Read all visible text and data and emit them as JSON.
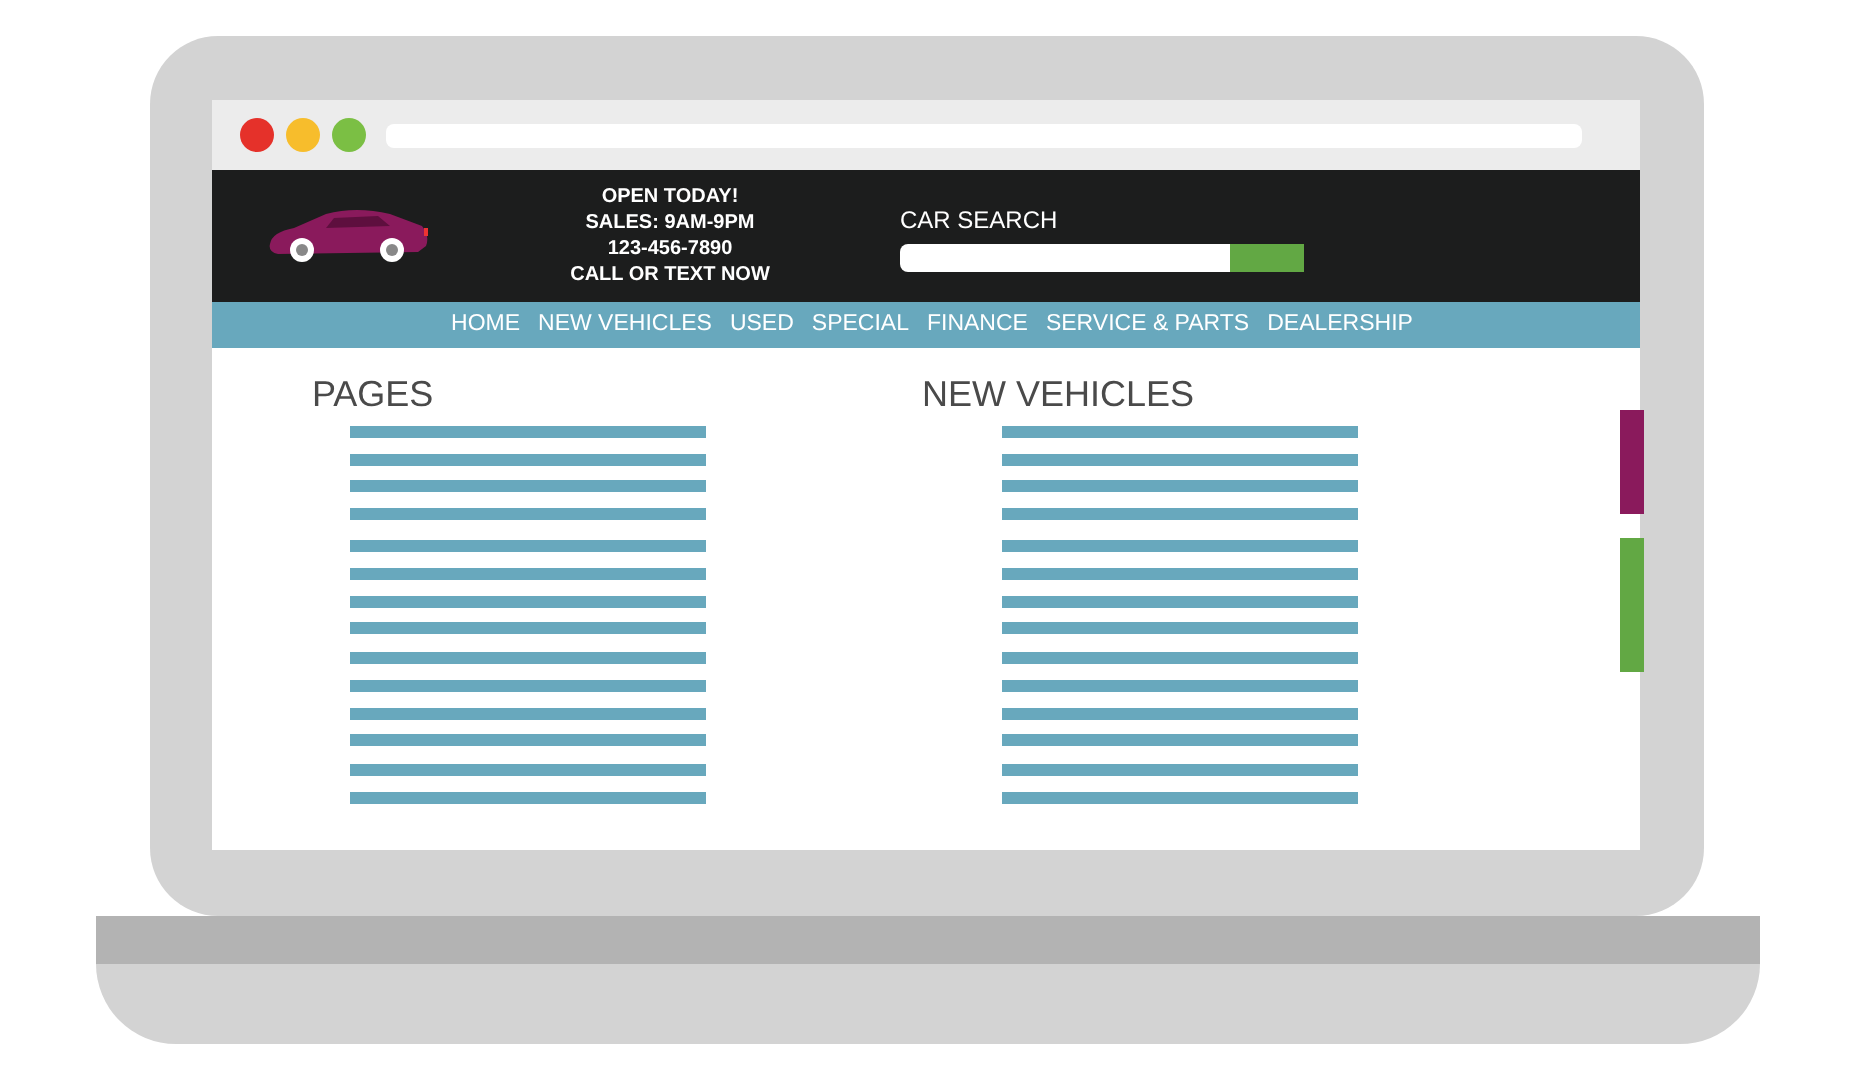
{
  "header": {
    "info_lines": [
      "OPEN TODAY!",
      "SALES: 9AM-9PM",
      "123-456-7890",
      "CALL OR TEXT NOW"
    ],
    "search": {
      "label": "CAR SEARCH"
    }
  },
  "nav": [
    "HOME",
    "NEW VEHICLES",
    "USED",
    "SPECIAL",
    "FINANCE",
    "SERVICE & PARTS",
    "DEALERSHIP"
  ],
  "sections": [
    {
      "title": "PAGES"
    },
    {
      "title": "NEW VEHICLES"
    }
  ],
  "side_tabs": [
    {
      "color": "#8a1a5c"
    },
    {
      "color": "#62a844"
    }
  ]
}
